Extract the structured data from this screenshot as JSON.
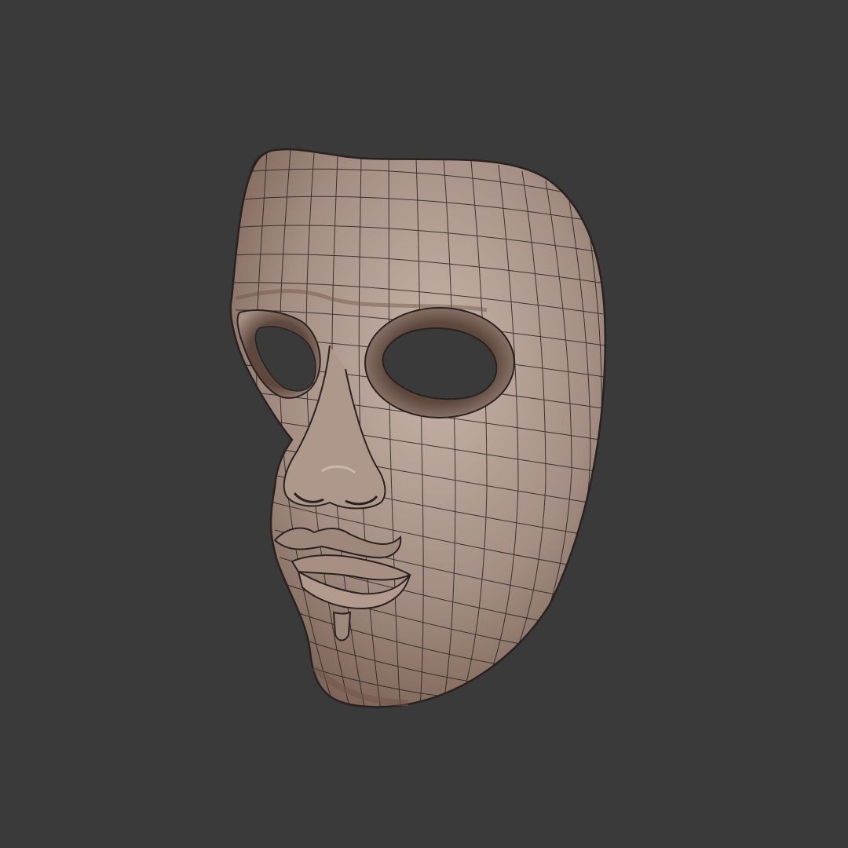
{
  "scene": {
    "background_color": "#3a3a3a",
    "subject": "mask-mesh",
    "material": {
      "base_color": "#a58f84",
      "highlight_color": "#c8b4a9",
      "shadow_color": "#6f5548",
      "wire_color": "#2a2220"
    }
  }
}
